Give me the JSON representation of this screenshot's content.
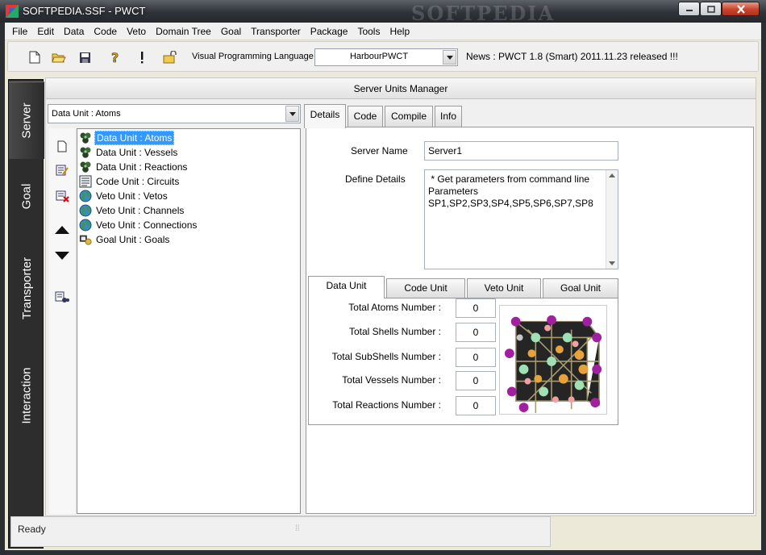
{
  "window": {
    "title": "SOFTPEDIA.SSF  -  PWCT",
    "watermark": "SOFTPEDIA"
  },
  "menu": [
    "File",
    "Edit",
    "Data",
    "Code",
    "Veto",
    "Domain Tree",
    "Goal",
    "Transporter",
    "Package",
    "Tools",
    "Help"
  ],
  "toolbar": {
    "icons": [
      "new-file-icon",
      "open-folder-icon",
      "save-icon",
      "help-icon",
      "exclamation-icon",
      "unlock-icon"
    ],
    "vpl_label": "Visual Programming Language",
    "vpl_value": "HarbourPWCT",
    "news": "News : PWCT 1.8 (Smart) 2011.11.23 released !!!"
  },
  "sidebar": {
    "tabs": [
      "Server",
      "Goal",
      "Transporter",
      "Interaction"
    ],
    "active": "Server"
  },
  "header": {
    "title": "Server Units Manager"
  },
  "data_unit_combo": {
    "value": "Data Unit : Atoms"
  },
  "tree": {
    "selected": 0,
    "items": [
      {
        "label": "Data Unit : Atoms",
        "icon": "data-unit-icon"
      },
      {
        "label": "Data Unit : Vessels",
        "icon": "data-unit-icon"
      },
      {
        "label": "Data Unit : Reactions",
        "icon": "data-unit-icon"
      },
      {
        "label": "Code Unit : Circuits",
        "icon": "code-unit-icon"
      },
      {
        "label": "Veto Unit : Vetos",
        "icon": "globe-icon"
      },
      {
        "label": "Veto Unit : Channels",
        "icon": "globe-icon"
      },
      {
        "label": "Veto Unit : Connections",
        "icon": "globe-icon"
      },
      {
        "label": "Goal Unit : Goals",
        "icon": "goal-icon"
      }
    ]
  },
  "tabs": {
    "items": [
      "Details",
      "Code",
      "Compile",
      "Info"
    ],
    "active": "Details"
  },
  "details": {
    "server_name_label": "Server Name",
    "server_name_value": "Server1",
    "define_details_label": "Define Details",
    "define_details_value": " * Get parameters from command line\nParameters\nSP1,SP2,SP3,SP4,SP5,SP6,SP7,SP8"
  },
  "inner_tabs": {
    "items": [
      "Data Unit",
      "Code Unit",
      "Veto Unit",
      "Goal Unit"
    ],
    "active": "Data Unit"
  },
  "counts": [
    {
      "label": "Total Atoms Number :",
      "value": "0"
    },
    {
      "label": "Total Shells Number :",
      "value": "0"
    },
    {
      "label": "Total SubShells Number :",
      "value": "0"
    },
    {
      "label": "Total Vessels Number :",
      "value": "0"
    },
    {
      "label": "Total Reactions Number :",
      "value": "0"
    }
  ],
  "status": {
    "text": "Ready"
  },
  "colors": {
    "selection": "#3399ff",
    "titlebar": "#2f3339",
    "sidebar": "#2d2d2d",
    "close_button": "#c8432b"
  }
}
